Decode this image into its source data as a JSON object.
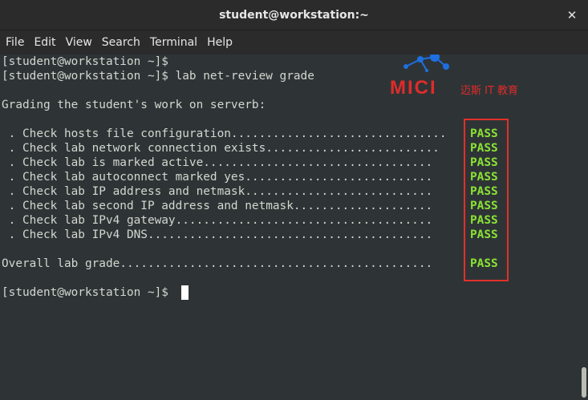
{
  "window": {
    "title": "student@workstation:~",
    "close_glyph": "✕"
  },
  "menubar": {
    "items": [
      "File",
      "Edit",
      "View",
      "Search",
      "Terminal",
      "Help"
    ]
  },
  "watermark": {
    "brand": "MICI",
    "subtitle": "迈斯 IT 教育"
  },
  "terminal": {
    "lines": [
      "[student@workstation ~]$",
      "[student@workstation ~]$ lab net-review grade",
      "",
      "Grading the student's work on serverb:",
      "",
      " . Check hosts file configuration...............................",
      " . Check lab network connection exists.........................",
      " . Check lab is marked active.................................",
      " . Check lab autoconnect marked yes...........................",
      " . Check lab IP address and netmask...........................",
      " . Check lab second IP address and netmask....................",
      " . Check lab IPv4 gateway.....................................",
      " . Check lab IPv4 DNS.........................................",
      "",
      "Overall lab grade.............................................",
      "",
      "[student@workstation ~]$ "
    ],
    "results": [
      "PASS",
      "PASS",
      "PASS",
      "PASS",
      "PASS",
      "PASS",
      "PASS",
      "PASS",
      "PASS"
    ]
  },
  "colors": {
    "pass": "#8ae234",
    "highlight_box": "#e0302a",
    "terminal_bg": "#2e3436",
    "text": "#d3d7cf"
  }
}
